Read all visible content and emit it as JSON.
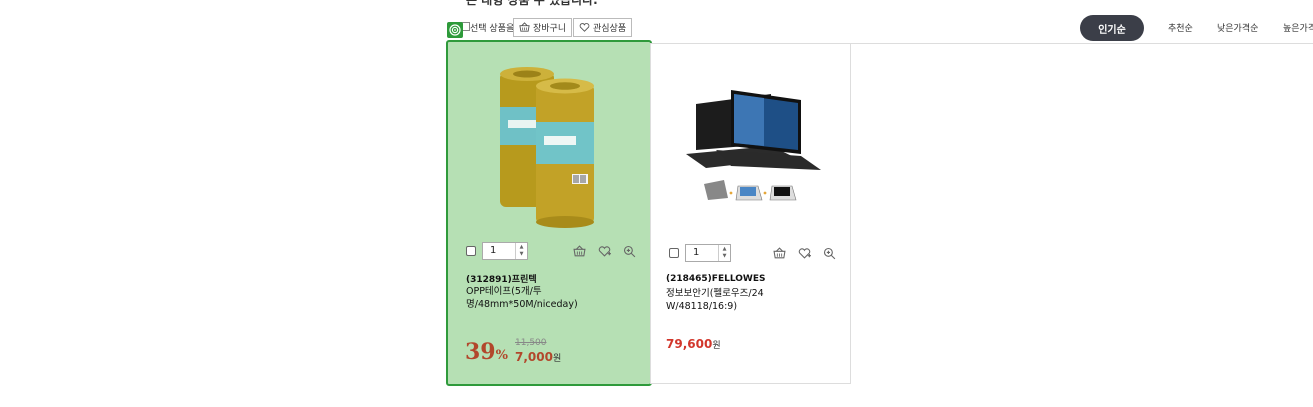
{
  "top_text": "은 대형 상품 수 있습니다.",
  "toolbar": {
    "select_label": "선택 상품을",
    "cart_button": "장바구니",
    "wish_button": "관심상품",
    "sort": {
      "active": "인기순",
      "options": [
        "추천순",
        "낮은가격순",
        "높은가격순"
      ]
    }
  },
  "products": [
    {
      "brand": "(312891)프린텍",
      "name": "OPP테이프(5개/투명/48mm*50M/niceday)",
      "quantity": "1",
      "discount": "39",
      "discount_unit": "%",
      "original_price": "11,500",
      "price": "7,000",
      "currency": "원",
      "image": "tape-rolls-image",
      "highlighted": true
    },
    {
      "brand": "(218465)FELLOWES",
      "name": "정보보안기(펠로우즈/24 W/48118/16:9)",
      "quantity": "1",
      "price": "79,600",
      "currency": "원",
      "image": "privacy-filter-laptop-image",
      "highlighted": false
    }
  ],
  "colors": {
    "highlight_bg": "#b6e0b4",
    "highlight_border": "#2f9a3b",
    "sort_active_bg": "#3b3e48",
    "price_red": "#d2362b"
  }
}
